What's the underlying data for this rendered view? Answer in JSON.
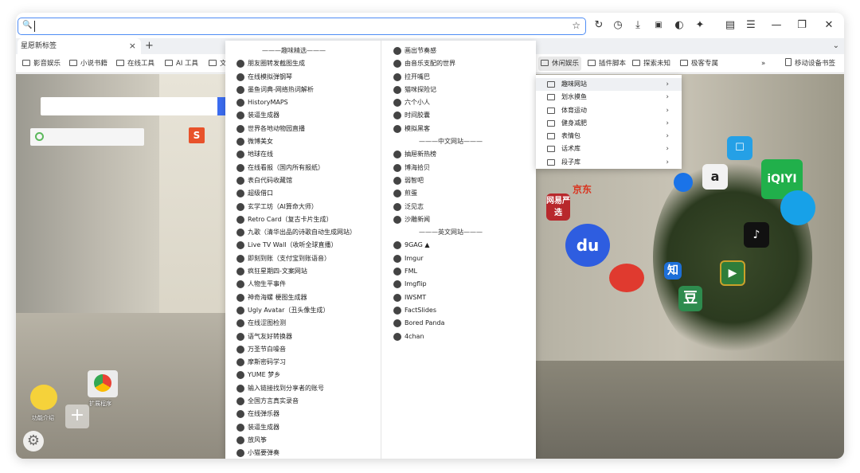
{
  "toolbar": {
    "right_icons": [
      "refresh-icon",
      "history-icon",
      "download-icon",
      "extension-icon",
      "dark-mode-icon",
      "puzzle-icon",
      "reader-icon",
      "menu-icon",
      "minimize-icon",
      "restore-icon",
      "close-icon"
    ]
  },
  "tab": {
    "title": "星愿新标签",
    "close": "×",
    "new": "+"
  },
  "bookmarks": [
    "影音娱乐",
    "小说书籍",
    "在线工具",
    "AI 工具",
    "文",
    "休闲娱乐",
    "插件脚本",
    "探索未知",
    "极客专属",
    "移动设备书签"
  ],
  "more": "»",
  "menu": {
    "col1": [
      {
        "label": "———趣味精选———",
        "sep": true
      },
      {
        "label": "朋友圈转发截图生成"
      },
      {
        "label": "在线模拟弹钢琴"
      },
      {
        "label": "墨鱼词典-网络热词解析"
      },
      {
        "label": "HistoryMAPS"
      },
      {
        "label": "装逼生成器"
      },
      {
        "label": "世界各地动物园直播"
      },
      {
        "label": "微博美女"
      },
      {
        "label": "地球在线"
      },
      {
        "label": "在线看报（国内所有报纸）"
      },
      {
        "label": "表白代码收藏馆"
      },
      {
        "label": "超级借口"
      },
      {
        "label": "玄学工坊（AI算命大师）"
      },
      {
        "label": "Retro Card（复古卡片生成）"
      },
      {
        "label": "九歌（清华出品的诗歌自动生成网站）"
      },
      {
        "label": "Live TV Wall（收听全球直播）"
      },
      {
        "label": "即刻到账（支付宝到账语音）"
      },
      {
        "label": "疯狂星期四-文案网站"
      },
      {
        "label": "人物生平事件"
      },
      {
        "label": "神奇海螺 梗图生成器"
      },
      {
        "label": "Ugly Avatar（丑头像生成）"
      },
      {
        "label": "在线涩图检测"
      },
      {
        "label": "语气友好转换器"
      },
      {
        "label": "万圣节白噪音"
      },
      {
        "label": "摩斯密码学习"
      },
      {
        "label": "YUME 梦乡"
      },
      {
        "label": "输入链接找到分享者的账号"
      },
      {
        "label": "全国方言真实录音"
      },
      {
        "label": "在线弹乐器"
      },
      {
        "label": "装逼生成器"
      },
      {
        "label": "放风筝"
      },
      {
        "label": "小猫要弹奏"
      }
    ],
    "col2": [
      {
        "label": "画出节奏感"
      },
      {
        "label": "由音乐支配的世界"
      },
      {
        "label": "拉开嘴巴"
      },
      {
        "label": "猫咪探险记"
      },
      {
        "label": "六个小人"
      },
      {
        "label": "时间胶囊"
      },
      {
        "label": "模拟黑客"
      },
      {
        "label": "———中文网站———",
        "sep": true
      },
      {
        "label": "抽屉新热榜"
      },
      {
        "label": "博海拾贝"
      },
      {
        "label": "弱智吧"
      },
      {
        "label": "煎蛋"
      },
      {
        "label": "泛见志"
      },
      {
        "label": "沙雕新闻"
      },
      {
        "label": "———英文网站———",
        "sep": true
      },
      {
        "label": "9GAG ▲"
      },
      {
        "label": "Imgur"
      },
      {
        "label": "FML"
      },
      {
        "label": "Imgflip"
      },
      {
        "label": "IWSMT"
      },
      {
        "label": "FactSlides"
      },
      {
        "label": "Bored Panda"
      },
      {
        "label": "4chan"
      }
    ]
  },
  "submenu": [
    "趣味网站",
    "划水摸鱼",
    "体育运动",
    "健身减肥",
    "表情包",
    "话术库",
    "段子库"
  ],
  "desktop": {
    "apps": [
      {
        "label": "功能介绍"
      },
      {
        "label": "扩展程序"
      },
      {
        "label": "网易严选"
      },
      {
        "label": "知"
      },
      {
        "label": "豆"
      },
      {
        "label": "抖音"
      },
      {
        "label": "爱奇艺"
      }
    ]
  },
  "colors": {
    "accent": "#4f8df5",
    "search_btn": "#3b6cf0"
  }
}
